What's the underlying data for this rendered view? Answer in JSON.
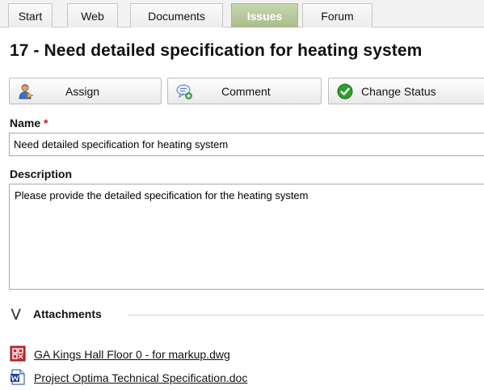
{
  "tabs": [
    {
      "label": "Start",
      "active": false
    },
    {
      "label": "Web",
      "active": false
    },
    {
      "label": "Documents",
      "active": false
    },
    {
      "label": "Issues",
      "active": true
    },
    {
      "label": "Forum",
      "active": false
    }
  ],
  "page_title": "17 - Need detailed specification for heating system",
  "toolbar": {
    "assign_label": "Assign",
    "comment_label": "Comment",
    "change_status_label": "Change Status"
  },
  "form": {
    "name_label": "Name",
    "required_marker": "*",
    "name_value": "Need detailed specification for heating system",
    "description_label": "Description",
    "description_value": "Please provide the detailed specification for the heating system"
  },
  "attachments": {
    "title": "Attachments",
    "items": [
      {
        "name": "GA Kings Hall Floor 0 - for markup.dwg",
        "icon": "dwg-file-icon"
      },
      {
        "name": "Project Optima Technical Specification.doc",
        "icon": "word-doc-icon"
      }
    ]
  },
  "colors": {
    "active_tab": "#b3c597",
    "required": "#d0161b",
    "status_check": "#2f9e2f",
    "word_blue": "#1c3f9a",
    "dwg_red": "#d6242a"
  }
}
